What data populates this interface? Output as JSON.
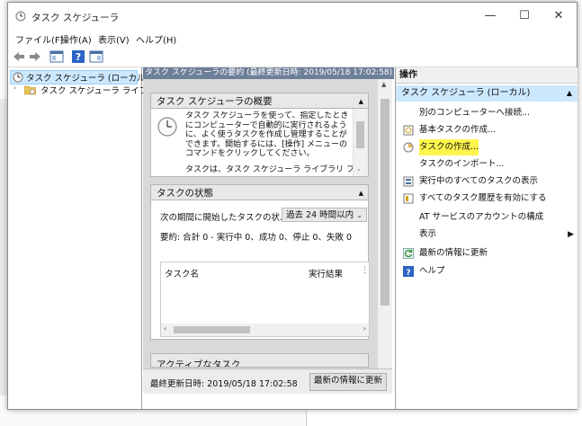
{
  "window": {
    "title": "タスク スケジューラ"
  },
  "window_controls": {
    "minimize": "—",
    "maximize": "☐",
    "close": "✕"
  },
  "menu": [
    "ファイル(F)",
    "操作(A)",
    "表示(V)",
    "ヘルプ(H)"
  ],
  "tree": {
    "root": "タスク スケジューラ (ローカル)",
    "child": "タスク スケジューラ ライブラリ"
  },
  "center": {
    "header": "タスク スケジューラの要約 (最終更新日時: 2019/05/18 17:02:58)",
    "overview": {
      "title": "タスク スケジューラの概要",
      "text": "タスク スケジューラを使って、指定したときにコンピューターで自動的に実行されるように、よく使うタスクを作成し管理することができます。開始するには、[操作] メニューのコマンドをクリックしてください。",
      "text2": "タスクは、タスク スケジューラ ライブラリ フォルダ"
    },
    "status": {
      "title": "タスクの状態",
      "label": "次の期間に開始したタスクの状...",
      "period": "過去 24 時間以内",
      "summary": "要約: 合計 0 - 実行中 0、成功 0、停止 0、失敗 0",
      "col_task": "タスク名",
      "col_result": "実行結果"
    },
    "active": {
      "title": "アクティブなタスク"
    },
    "last_update": "最終更新日時: 2019/05/18 17:02:58",
    "refresh_button": "最新の情報に更新"
  },
  "actions": {
    "title": "操作",
    "section": "タスク スケジューラ (ローカル)",
    "items": [
      "別のコンピューターへ接続...",
      "基本タスクの作成...",
      "タスクの作成...",
      "タスクのインポート...",
      "実行中のすべてのタスクの表示",
      "すべてのタスク履歴を有効にする",
      "AT サービスのアカウントの構成",
      "表示",
      "最新の情報に更新",
      "ヘルプ"
    ]
  },
  "colors": {
    "highlight": "#fff64d",
    "selection": "#cce8ff",
    "header": "#6e7f99"
  }
}
